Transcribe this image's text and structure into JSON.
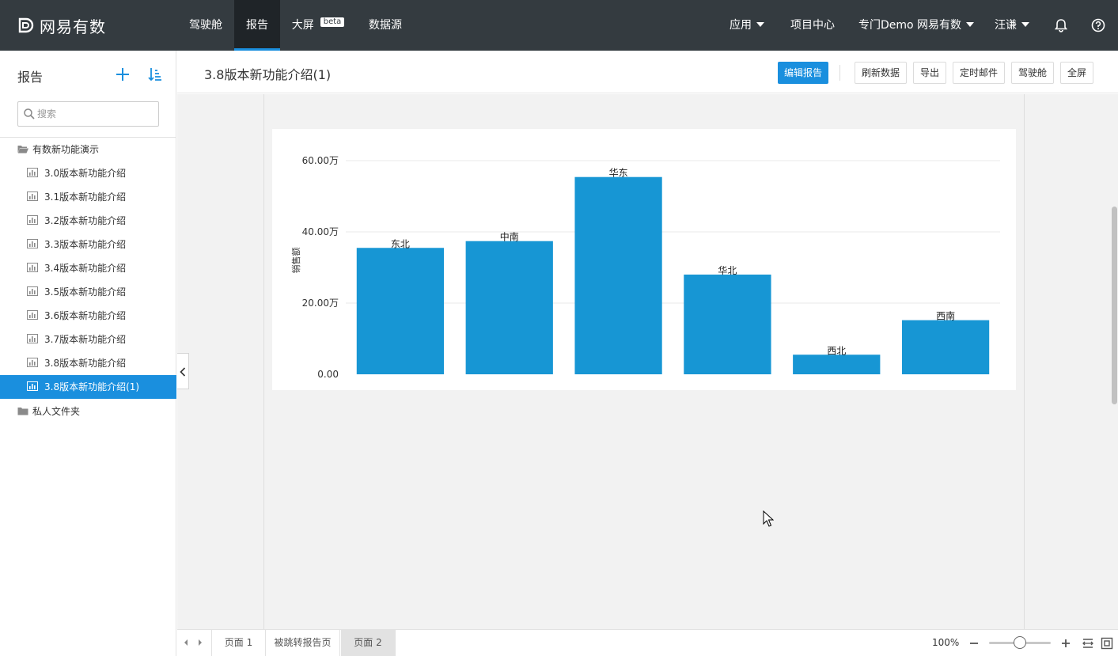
{
  "app": {
    "logo_text": "网易有数"
  },
  "topnav": {
    "items": [
      {
        "label": "驾驶舱"
      },
      {
        "label": "报告"
      },
      {
        "label": "大屏",
        "badge": "beta"
      },
      {
        "label": "数据源"
      }
    ],
    "right": {
      "apps": "应用",
      "projects": "项目中心",
      "workspace": "专门Demo 网易有数",
      "user": "汪谦"
    },
    "icons": [
      "bell-icon",
      "help-icon"
    ]
  },
  "sidebar": {
    "title": "报告",
    "search_placeholder": "搜索",
    "folders": [
      {
        "label": "有数新功能演示",
        "items": [
          {
            "label": "3.0版本新功能介绍"
          },
          {
            "label": "3.1版本新功能介绍"
          },
          {
            "label": "3.2版本新功能介绍"
          },
          {
            "label": "3.3版本新功能介绍"
          },
          {
            "label": "3.4版本新功能介绍"
          },
          {
            "label": "3.5版本新功能介绍"
          },
          {
            "label": "3.6版本新功能介绍"
          },
          {
            "label": "3.7版本新功能介绍"
          },
          {
            "label": "3.8版本新功能介绍"
          },
          {
            "label": "3.8版本新功能介绍(1)",
            "active": true
          }
        ]
      },
      {
        "label": "私人文件夹",
        "items": []
      }
    ]
  },
  "header": {
    "report_title": "3.8版本新功能介绍(1)",
    "buttons": {
      "edit": "编辑报告",
      "refresh": "刷新数据",
      "export": "导出",
      "schedule": "定时邮件",
      "cockpit": "驾驶舱",
      "fullscreen": "全屏"
    }
  },
  "bottombar": {
    "pages": [
      {
        "label": "页面 1"
      },
      {
        "label": "被跳转报告页"
      },
      {
        "label": "页面 2",
        "active": true
      }
    ],
    "zoom": "100%",
    "zoom_fraction": 0.5
  },
  "colors": {
    "topbar": "#343b40",
    "accent": "#1a8fde",
    "bar": "#1796d4"
  },
  "chart_data": {
    "type": "bar",
    "categories": [
      "东北",
      "中南",
      "华东",
      "华北",
      "西北",
      "西南"
    ],
    "values": [
      355000,
      374000,
      554000,
      280000,
      55000,
      152000
    ],
    "ylabel": "销售额",
    "yticks": [
      0,
      200000,
      400000,
      600000
    ],
    "ytick_labels": [
      "0.00",
      "20.00万",
      "40.00万",
      "60.00万"
    ],
    "ylim": [
      0,
      600000
    ],
    "grid": true,
    "data_labels": "category-above-bar"
  }
}
